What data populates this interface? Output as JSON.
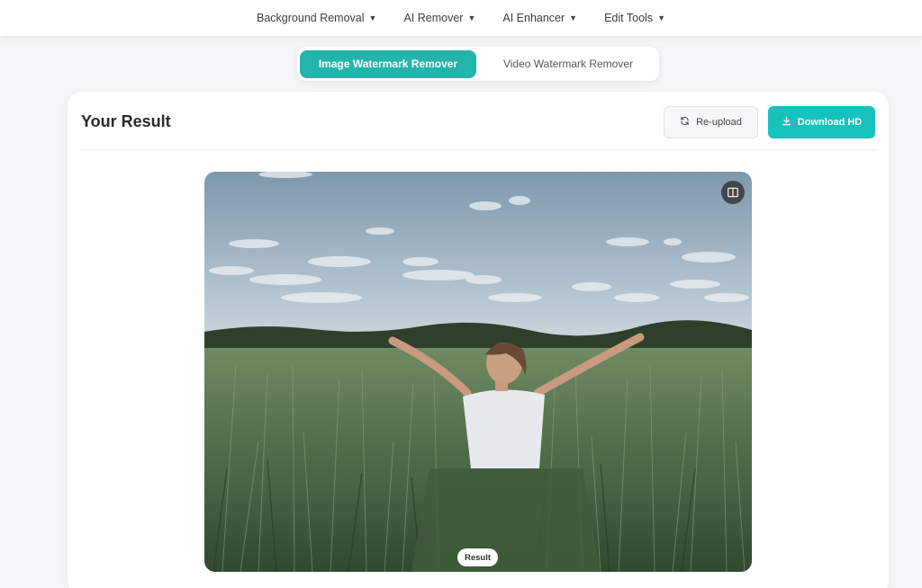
{
  "nav": {
    "items": [
      {
        "label": "Background Removal"
      },
      {
        "label": "AI Remover"
      },
      {
        "label": "AI Enhancer"
      },
      {
        "label": "Edit Tools"
      }
    ],
    "caret": "▼"
  },
  "mode_toggle": {
    "options": [
      {
        "label": "Image Watermark Remover",
        "active": true
      },
      {
        "label": "Video Watermark Remover",
        "active": false
      }
    ]
  },
  "result_card": {
    "title": "Your Result",
    "reupload_label": "Re-upload",
    "download_label": "Download HD",
    "image_badge": "Result"
  },
  "colors": {
    "accent": "#26b3aa",
    "download": "#17c2bc",
    "page_bg": "#f5f6f8"
  },
  "icons": {
    "reupload": "refresh-icon",
    "download": "download-icon",
    "compare": "compare-split-icon",
    "caret": "caret-down-icon"
  }
}
